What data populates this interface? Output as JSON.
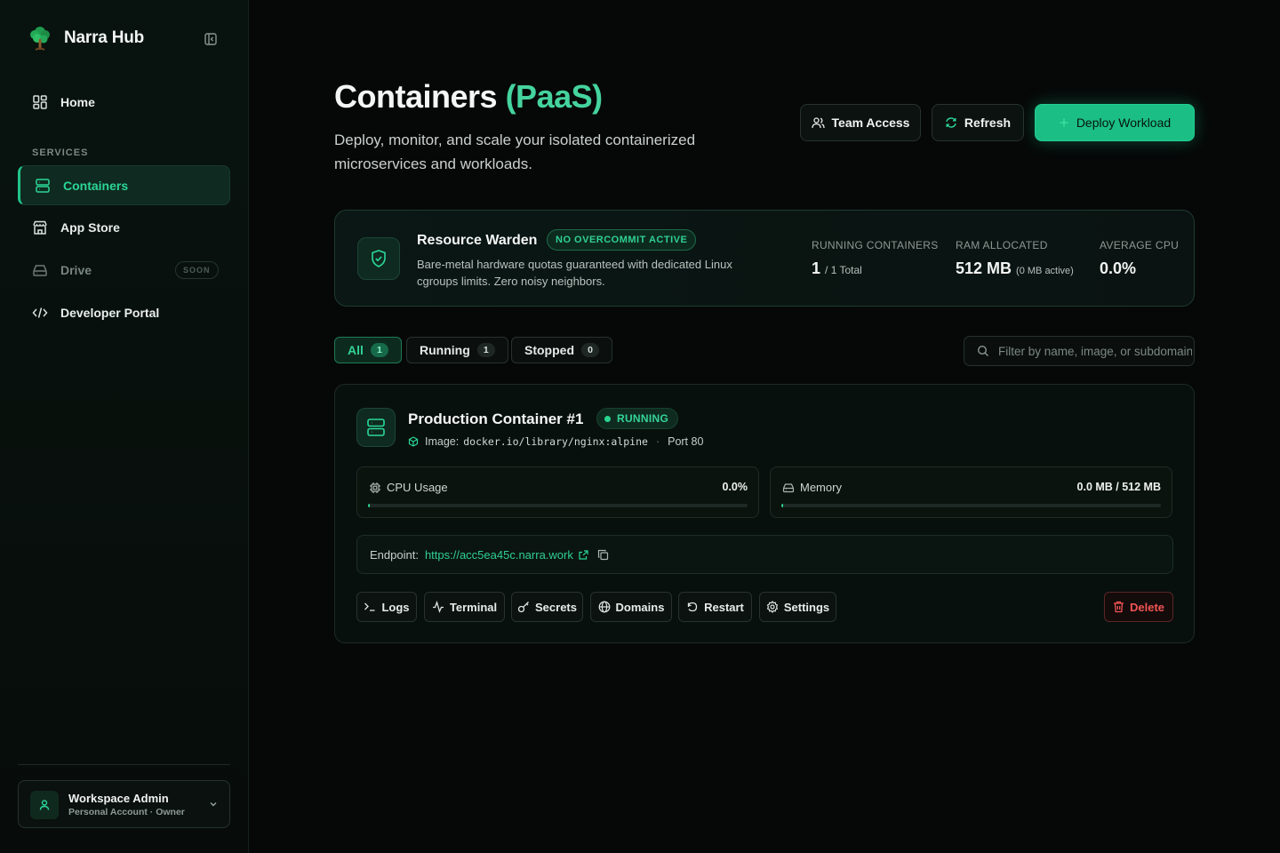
{
  "app": {
    "name": "Narra Hub"
  },
  "sidebar": {
    "home": "Home",
    "section_label": "SERVICES",
    "items": [
      {
        "label": "Containers",
        "icon": "server-icon",
        "active": true
      },
      {
        "label": "App Store",
        "icon": "store-icon"
      },
      {
        "label": "Drive",
        "icon": "drive-icon",
        "badge": "SOON",
        "disabled": true
      },
      {
        "label": "Developer Portal",
        "icon": "code-icon"
      }
    ],
    "account": {
      "name": "Workspace Admin",
      "subtitle": "Personal Account · Owner"
    }
  },
  "header": {
    "title": "Containers",
    "title_accent": "(PaaS)",
    "subtitle": "Deploy, monitor, and scale your isolated containerized microservices and workloads.",
    "buttons": {
      "team_access": "Team Access",
      "refresh": "Refresh",
      "deploy": "Deploy Workload"
    }
  },
  "warden": {
    "title": "Resource Warden",
    "badge": "NO OVERCOMMIT ACTIVE",
    "description": "Bare-metal hardware quotas guaranteed with dedicated Linux cgroups limits. Zero noisy neighbors.",
    "stats": {
      "running_label": "RUNNING CONTAINERS",
      "running_value": "1",
      "running_total": "/ 1 Total",
      "ram_label": "RAM ALLOCATED",
      "ram_value": "512 MB",
      "ram_active": "(0 MB active)",
      "cpu_label": "AVERAGE CPU",
      "cpu_value": "0.0%"
    }
  },
  "filters": {
    "tabs": [
      {
        "label": "All",
        "count": "1",
        "active": true
      },
      {
        "label": "Running",
        "count": "1"
      },
      {
        "label": "Stopped",
        "count": "0"
      }
    ],
    "search_placeholder": "Filter by name, image, or subdomain..."
  },
  "container": {
    "name": "Production Container #1",
    "status": "RUNNING",
    "image_label": "Image:",
    "image": "docker.io/library/nginx:alpine",
    "separator": "·",
    "port": "Port 80",
    "cpu": {
      "label": "CPU Usage",
      "value": "0.0%",
      "fraction": 0.0
    },
    "memory": {
      "label": "Memory",
      "value": "0.0 MB / 512 MB",
      "fraction": 0.0
    },
    "endpoint_label": "Endpoint:",
    "endpoint_url": "https://acc5ea45c.narra.work",
    "actions": {
      "logs": "Logs",
      "terminal": "Terminal",
      "secrets": "Secrets",
      "domains": "Domains",
      "restart": "Restart",
      "settings": "Settings",
      "delete": "Delete"
    }
  },
  "colors": {
    "accent": "#1bbf85",
    "accent_text": "#2bd697",
    "danger": "#f05454",
    "background": "#060808"
  }
}
